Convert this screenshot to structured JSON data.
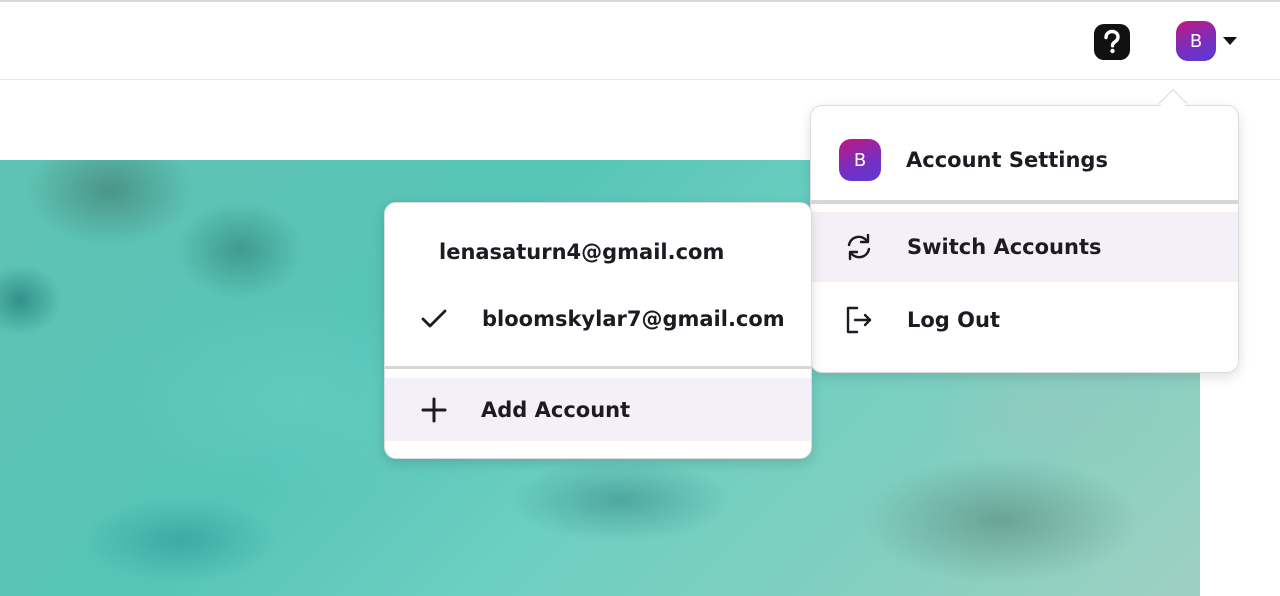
{
  "header": {
    "help_icon": "question-mark-icon",
    "avatar_initial": "B",
    "dropdown_icon": "caret-down-icon"
  },
  "account_menu": {
    "settings": {
      "avatar_initial": "B",
      "label": "Account Settings"
    },
    "switch_accounts": {
      "icon": "refresh-arrows-icon",
      "label": "Switch Accounts"
    },
    "log_out": {
      "icon": "logout-arrow-icon",
      "label": "Log Out"
    }
  },
  "switch_menu": {
    "accounts": [
      {
        "email": "lenasaturn4@gmail.com",
        "selected": false
      },
      {
        "email": "bloomskylar7@gmail.com",
        "selected": true
      }
    ],
    "add_account": {
      "icon": "plus-icon",
      "label": "Add Account"
    }
  },
  "colors": {
    "avatar_gradient_start": "#c2187f",
    "avatar_gradient_end": "#5b3ad3",
    "highlight_row": "#f5f0f7",
    "text": "#1e1a22"
  }
}
